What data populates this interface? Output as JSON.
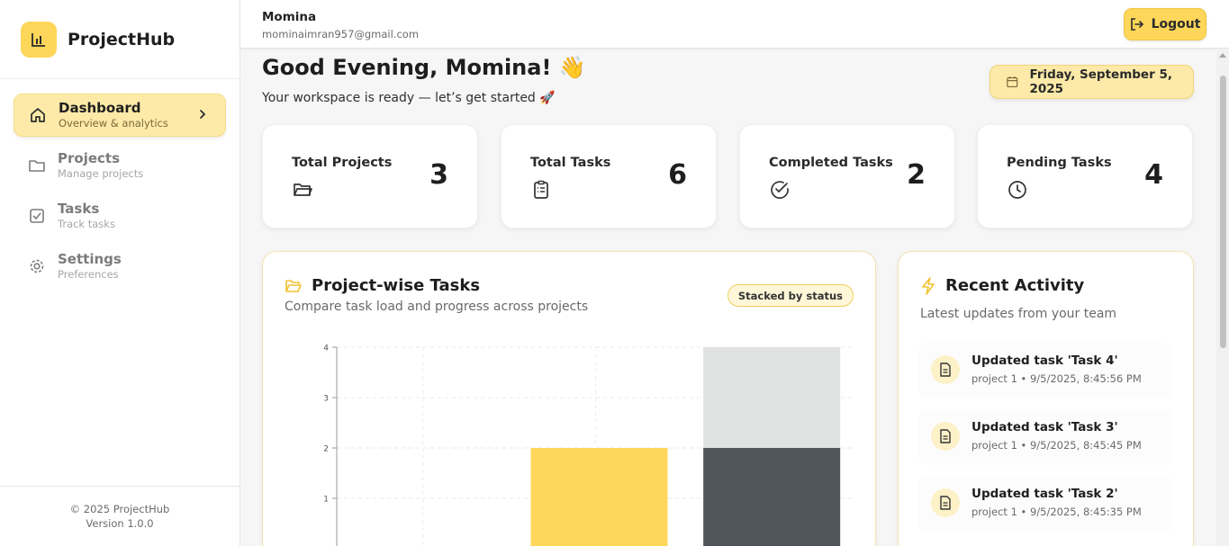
{
  "app": {
    "name": "ProjectHub"
  },
  "sidebar": {
    "items": [
      {
        "label": "Dashboard",
        "sub": "Overview & analytics"
      },
      {
        "label": "Projects",
        "sub": "Manage projects"
      },
      {
        "label": "Tasks",
        "sub": "Track tasks"
      },
      {
        "label": "Settings",
        "sub": "Preferences"
      }
    ],
    "footer": {
      "copyright": "© 2025 ProjectHub",
      "version": "Version 1.0.0"
    }
  },
  "topbar": {
    "user_name": "Momina",
    "user_email": "mominaimran957@gmail.com",
    "logout_label": "Logout"
  },
  "greeting": {
    "title": "Good Evening, Momina! 👋",
    "subtitle": "Your workspace is ready — let’s get started 🚀",
    "date": "Friday, September 5, 2025"
  },
  "stats": [
    {
      "label": "Total Projects",
      "value": "3",
      "icon": "folder-icon"
    },
    {
      "label": "Total Tasks",
      "value": "6",
      "icon": "clipboard-icon"
    },
    {
      "label": "Completed Tasks",
      "value": "2",
      "icon": "check-circle-icon"
    },
    {
      "label": "Pending Tasks",
      "value": "4",
      "icon": "clock-icon"
    }
  ],
  "chart_card": {
    "title": "Project-wise Tasks",
    "subtitle": "Compare task load and progress across projects",
    "badge": "Stacked by status"
  },
  "chart_data": {
    "type": "bar",
    "stacked": true,
    "y_ticks": [
      "1",
      "2",
      "3",
      "4"
    ],
    "ylim": [
      0,
      4
    ],
    "grid": true,
    "series": [
      {
        "values": [
          0,
          2,
          2
        ],
        "color": "#fdd65a"
      },
      {
        "values": [
          0,
          0,
          2
        ],
        "color": "#e0e1e1"
      }
    ],
    "colors": {
      "yellow": "#fdd65a",
      "dark": "#50555b",
      "light": "#e0e1e1"
    },
    "bars": [
      {
        "segments": []
      },
      {
        "segments": [
          {
            "value": 2,
            "color": "#fdd65a"
          }
        ]
      },
      {
        "segments": [
          {
            "value": 2,
            "color": "#50555b"
          },
          {
            "value": 2,
            "color": "#e0e1e1"
          }
        ]
      }
    ]
  },
  "activity": {
    "title": "Recent Activity",
    "subtitle": "Latest updates from your team",
    "items": [
      {
        "title": "Updated task 'Task 4'",
        "meta": "project 1 • 9/5/2025, 8:45:56 PM"
      },
      {
        "title": "Updated task 'Task 3'",
        "meta": "project 1 • 9/5/2025, 8:45:45 PM"
      },
      {
        "title": "Updated task 'Task 2'",
        "meta": "project 1 • 9/5/2025, 8:45:35 PM"
      }
    ]
  },
  "colors": {
    "accent": "#fdd65a",
    "accent_light": "#fdeaa8"
  }
}
